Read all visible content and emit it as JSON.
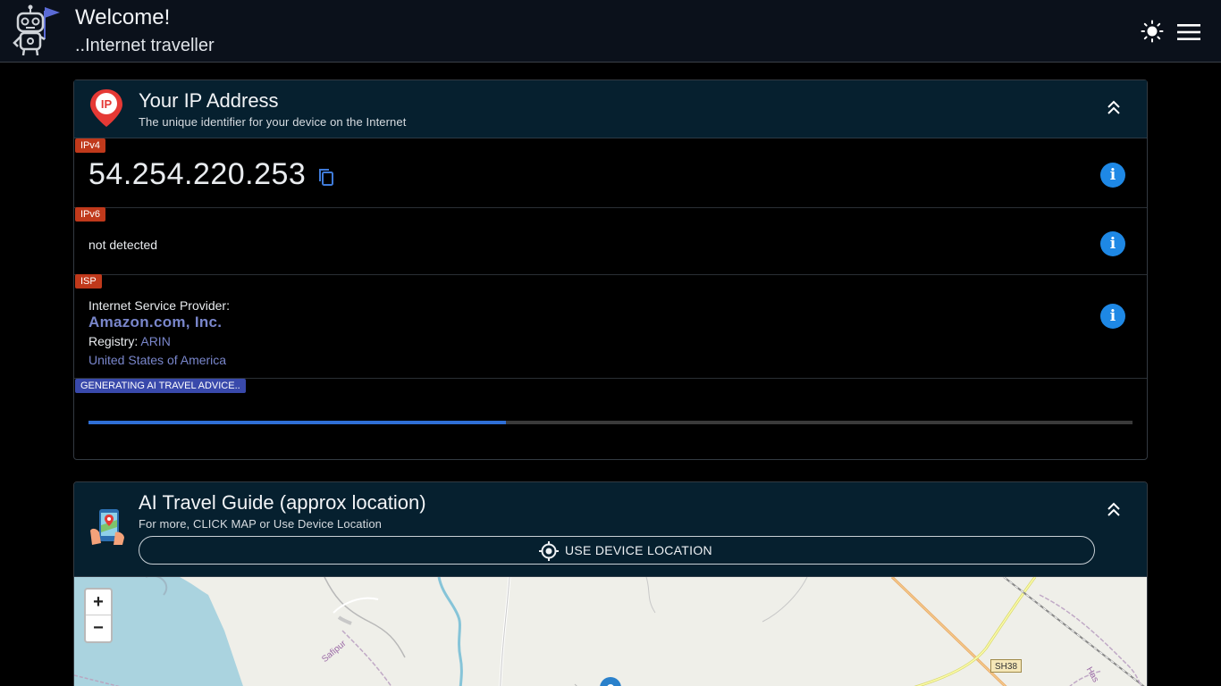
{
  "header": {
    "title": "Welcome!",
    "subtitle": "..Internet traveller",
    "theme_icon": "sun-icon",
    "menu_icon": "hamburger-menu-icon"
  },
  "ip_card": {
    "title": "Your IP Address",
    "subtitle": "The unique identifier for your device on the Internet",
    "ipv4": {
      "tag": "IPv4",
      "value": "54.254.220.253"
    },
    "ipv6": {
      "tag": "IPv6",
      "value": "not detected"
    },
    "isp": {
      "tag": "ISP",
      "label": "Internet Service Provider:",
      "name": "Amazon.com, Inc.",
      "registry_label": "Registry:",
      "registry_value": "ARIN",
      "country": "United States of America"
    },
    "advice": {
      "tag": "GENERATING AI TRAVEL ADVICE..",
      "progress_percent": 40
    }
  },
  "guide_card": {
    "title": "AI Travel Guide (approx location)",
    "subtitle": "For more, CLICK MAP or Use Device Location",
    "button_label": "USE DEVICE LOCATION"
  },
  "map": {
    "zoom_in": "+",
    "zoom_out": "−",
    "place_label": "Safipur",
    "road_label": "SH38",
    "road_label_2": "Has"
  },
  "colors": {
    "accent": "#1e88e5",
    "tag_red": "#c0391b",
    "tag_blue": "#3949ab",
    "link": "#7986cb",
    "header_bg": "#06202f"
  }
}
